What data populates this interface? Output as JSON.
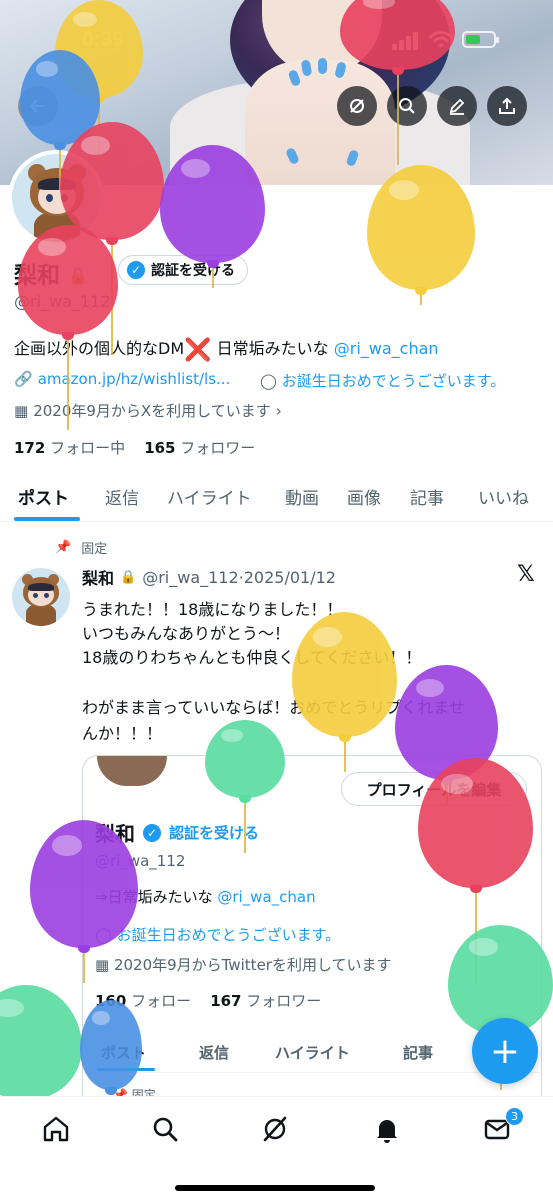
{
  "status": {
    "time": "0:39"
  },
  "profile": {
    "name": "梨和",
    "verify_label": "認証を受ける",
    "handle": "@ri_wa_112",
    "bio_text": "企画以外の個人的なDM",
    "bio_mark": "❌",
    "bio_text2": " 日常垢みたいな ",
    "bio_mention": "@ri_wa_chan",
    "link": "amazon.jp/hz/wishlist/ls...",
    "birthday": "お誕生日おめでとうございます。",
    "joined": "2020年9月からXを利用しています",
    "following_count": "172",
    "following_label": "フォロー中",
    "followers_count": "165",
    "followers_label": "フォロワー"
  },
  "tabs": [
    "ポスト",
    "返信",
    "ハイライト",
    "動画",
    "画像",
    "記事",
    "いいね"
  ],
  "tweet": {
    "pinned_label": "固定",
    "name": "梨和",
    "handle_date": "@ri_wa_112·2025/01/12",
    "lines": [
      "うまれた！！18歳になりました！！",
      "いつもみんなありがとう〜！",
      "18歳のりわちゃんとも仲良くしてください！！",
      "わがまま言っていいならば！おめでとうリプくれませ",
      "んか！！！"
    ]
  },
  "card": {
    "edit_label": "プロフィールを編集",
    "name": "梨和",
    "verify_label": "認証を受ける",
    "handle": "@ri_wa_112",
    "bio_prefix": "⇒日常垢みたいな ",
    "bio_mention": "@ri_wa_chan",
    "birthday": "お誕生日おめでとうございます。",
    "joined": "2020年9月からTwitterを利用しています",
    "following_count": "160",
    "following_label": "フォロー",
    "followers_count": "167",
    "followers_label": "フォロワー",
    "tabs": [
      "ポスト",
      "返信",
      "ハイライト",
      "記事"
    ],
    "pinned_label": "固定"
  },
  "fab_label": "+",
  "nav": {
    "messages_badge": "3"
  },
  "colors": {
    "accent": "#1d9bf0",
    "text": "#0f1419",
    "muted": "#536471"
  }
}
